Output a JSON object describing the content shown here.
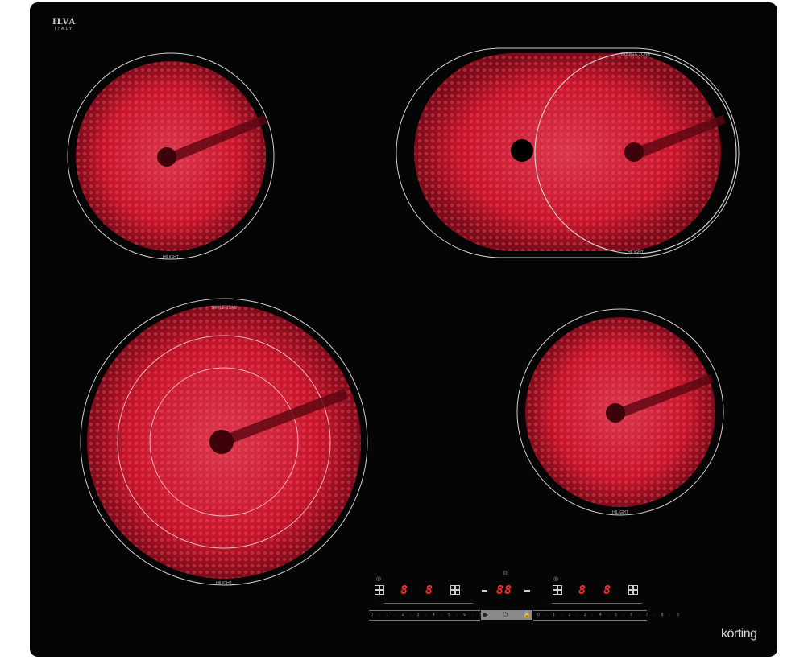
{
  "hob": {
    "logo_top_left": {
      "name": "ILVA",
      "sub": "ITALY"
    },
    "brand": "körting",
    "zones": [
      {
        "id": "rear-left",
        "label": "HILIGHT"
      },
      {
        "id": "rear-right",
        "label_top": "DOUBLE ZONE",
        "label_bottom": "HILIGHT"
      },
      {
        "id": "front-left",
        "label_top": "TRIPLE ZONE",
        "label_bottom": "HILIGHT"
      },
      {
        "id": "front-right",
        "label": "HILIGHT"
      }
    ],
    "control_panel": {
      "left_displays": [
        "8",
        "8"
      ],
      "center_display": "88",
      "right_displays": [
        "8",
        "8"
      ],
      "slider_scale": "0 · 1 · 2 · 3 · 4 · 5 · 6 · 7 · 8 · 9",
      "center_icons": {
        "play": "▶",
        "power": "⏻",
        "lock": "🔒"
      }
    },
    "colors": {
      "glass": "#050505",
      "zone_red": "#c8162c",
      "display_red": "#ff2a2a"
    }
  }
}
